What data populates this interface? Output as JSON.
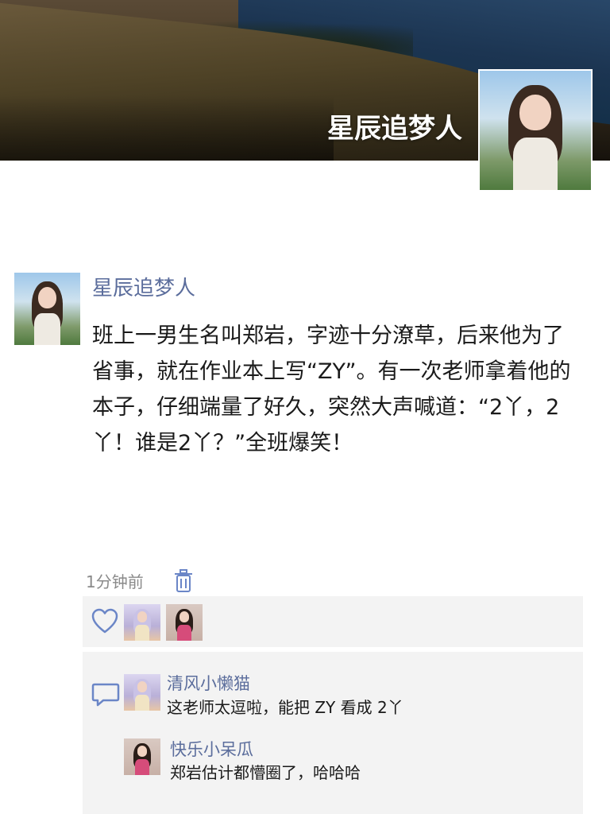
{
  "cover": {
    "name": "星辰追梦人"
  },
  "post": {
    "author": "星辰追梦人",
    "content": "班上一男生名叫郑岩，字迹十分潦草，后来他为了省事，就在作业本上写“ZY”。有一次老师拿着他的本子，仔细端量了好久，突然大声喊道：“2丫，2丫！谁是2丫？”全班爆笑！",
    "time": "1分钟前"
  },
  "likes": {
    "icon": "heart-icon",
    "avatars": [
      "anime-girl-avatar",
      "woman-pink-avatar"
    ]
  },
  "comments": [
    {
      "name": "清风小懒猫",
      "text": "这老师太逗啦，能把 ZY 看成 2丫"
    },
    {
      "name": "快乐小呆瓜",
      "text": "郑岩估计都懵圈了，哈哈哈"
    }
  ],
  "colors": {
    "link": "#5b6d9c",
    "accent_icon": "#6b86c7",
    "panel_bg": "#f3f3f3"
  }
}
